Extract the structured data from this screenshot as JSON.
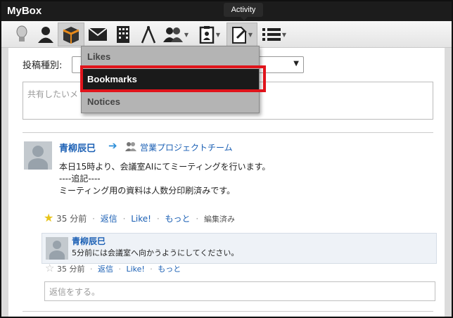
{
  "app": {
    "title": "MyBox"
  },
  "tooltip": "Activity",
  "toolbar": {
    "buttons": [
      {
        "icon": "lightbulb-icon"
      },
      {
        "icon": "user-icon"
      },
      {
        "icon": "box-icon"
      },
      {
        "icon": "mail-icon"
      },
      {
        "icon": "building-icon"
      },
      {
        "icon": "compass-icon"
      },
      {
        "icon": "group-icon"
      },
      {
        "icon": "clipboard-icon"
      },
      {
        "icon": "activity-icon"
      },
      {
        "icon": "list-icon"
      }
    ]
  },
  "menu": {
    "items": [
      "Likes",
      "Bookmarks",
      "Notices"
    ],
    "selected": "Bookmarks"
  },
  "form": {
    "post_type_label": "投稿種別:",
    "share_placeholder": "共有したいメ"
  },
  "post": {
    "author": "青柳辰巳",
    "group": "営業プロジェクトチーム",
    "body_lines": [
      "本日15時より、会議室AIにてミーティングを行います。",
      "----追記----",
      "ミーティング用の資料は人数分印刷済みです。"
    ],
    "time": "35 分前",
    "reply_link": "返信",
    "like_link": "Like!",
    "more_link": "もっと",
    "edited": "編集済み"
  },
  "reply": {
    "author": "青柳辰巳",
    "body": "5分前には会議室へ向かうようにしてください。",
    "time": "35 分前",
    "reply_link": "返信",
    "like_link": "Like!",
    "more_link": "もっと"
  },
  "reply_input": {
    "placeholder": "返信をする。"
  },
  "colors": {
    "accent": "#1a5fb4",
    "highlight": "#e0141b",
    "menu_selected": "#1a1a1a"
  }
}
